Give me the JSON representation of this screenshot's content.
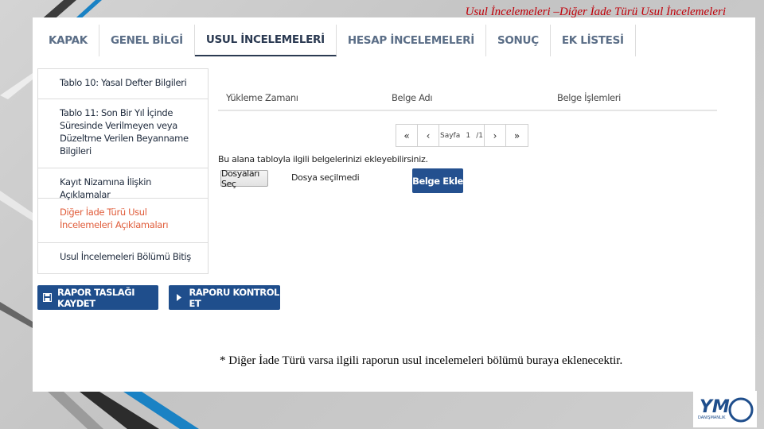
{
  "slide": {
    "title": "Usul İncelemeleri –Diğer İade Türü Usul İncelemeleri",
    "note": "* Diğer İade Türü varsa ilgili raporun usul incelemeleri bölümü buraya eklenecektir."
  },
  "tabs": [
    {
      "label": "KAPAK",
      "active": false
    },
    {
      "label": "GENEL BİLGİ",
      "active": false
    },
    {
      "label": "USUL İNCELEMELERİ",
      "active": true
    },
    {
      "label": "HESAP İNCELEMELERİ",
      "active": false
    },
    {
      "label": "SONUÇ",
      "active": false
    },
    {
      "label": "EK LİSTESİ",
      "active": false
    }
  ],
  "menu": {
    "items": [
      {
        "label": "Tablo 10: Yasal Defter Bilgileri"
      },
      {
        "label": "Tablo 11: Son Bir Yıl İçinde Süresinde Verilmeyen veya Düzeltme Verilen Beyanname Bilgileri"
      },
      {
        "label": "Kayıt Nizamına İlişkin Açıklamalar"
      },
      {
        "label": "Diğer İade Türü Usul İncelemeleri Açıklamaları"
      },
      {
        "label": "Usul İncelemeleri Bölümü Bitiş"
      }
    ]
  },
  "table": {
    "columns": [
      "Yükleme Zamanı",
      "Belge Adı",
      "Belge İşlemleri"
    ]
  },
  "pager": {
    "page_label": "Sayfa",
    "current": "1",
    "total": "/1",
    "first": "«",
    "prev": "‹",
    "next": "›",
    "last": "»"
  },
  "upload": {
    "hint": "Bu alana tabloyla ilgili belgelerinizi ekleyebilirsiniz.",
    "choose_label": "Dosyaları Seç",
    "status": "Dosya seçilmedi",
    "add_label": "Belge Ekle"
  },
  "actions": {
    "save_label": "RAPOR TASLAĞI KAYDET",
    "check_label": "RAPORU KONTROL ET"
  },
  "logo": {
    "text": "YM",
    "subtext": "DANIŞMANLIK"
  },
  "colors": {
    "title_red": "#c0000a",
    "active_menu": "#e05d3b",
    "button_blue": "#1f4e8c",
    "stripe_blue": "#1a82c4",
    "stripe_dark": "#3c3c3c"
  }
}
